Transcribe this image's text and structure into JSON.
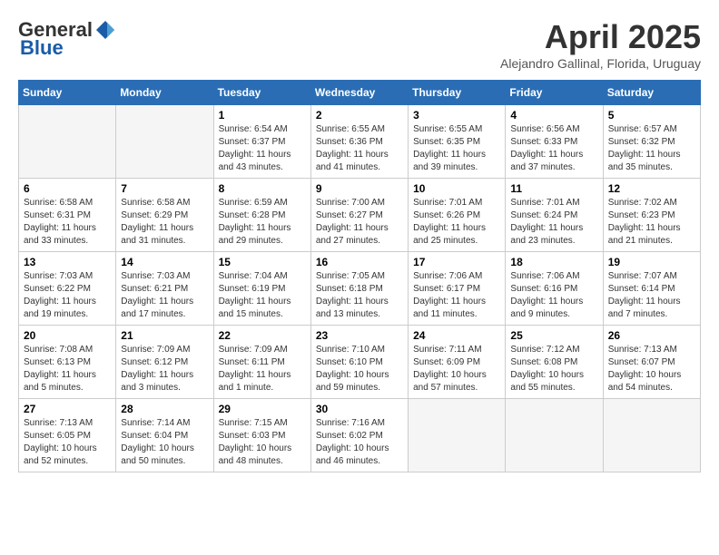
{
  "header": {
    "logo_general": "General",
    "logo_blue": "Blue",
    "month_title": "April 2025",
    "subtitle": "Alejandro Gallinal, Florida, Uruguay"
  },
  "days_of_week": [
    "Sunday",
    "Monday",
    "Tuesday",
    "Wednesday",
    "Thursday",
    "Friday",
    "Saturday"
  ],
  "weeks": [
    [
      {
        "day": "",
        "empty": true
      },
      {
        "day": "",
        "empty": true
      },
      {
        "day": "1",
        "info": "Sunrise: 6:54 AM\nSunset: 6:37 PM\nDaylight: 11 hours and 43 minutes."
      },
      {
        "day": "2",
        "info": "Sunrise: 6:55 AM\nSunset: 6:36 PM\nDaylight: 11 hours and 41 minutes."
      },
      {
        "day": "3",
        "info": "Sunrise: 6:55 AM\nSunset: 6:35 PM\nDaylight: 11 hours and 39 minutes."
      },
      {
        "day": "4",
        "info": "Sunrise: 6:56 AM\nSunset: 6:33 PM\nDaylight: 11 hours and 37 minutes."
      },
      {
        "day": "5",
        "info": "Sunrise: 6:57 AM\nSunset: 6:32 PM\nDaylight: 11 hours and 35 minutes."
      }
    ],
    [
      {
        "day": "6",
        "info": "Sunrise: 6:58 AM\nSunset: 6:31 PM\nDaylight: 11 hours and 33 minutes."
      },
      {
        "day": "7",
        "info": "Sunrise: 6:58 AM\nSunset: 6:29 PM\nDaylight: 11 hours and 31 minutes."
      },
      {
        "day": "8",
        "info": "Sunrise: 6:59 AM\nSunset: 6:28 PM\nDaylight: 11 hours and 29 minutes."
      },
      {
        "day": "9",
        "info": "Sunrise: 7:00 AM\nSunset: 6:27 PM\nDaylight: 11 hours and 27 minutes."
      },
      {
        "day": "10",
        "info": "Sunrise: 7:01 AM\nSunset: 6:26 PM\nDaylight: 11 hours and 25 minutes."
      },
      {
        "day": "11",
        "info": "Sunrise: 7:01 AM\nSunset: 6:24 PM\nDaylight: 11 hours and 23 minutes."
      },
      {
        "day": "12",
        "info": "Sunrise: 7:02 AM\nSunset: 6:23 PM\nDaylight: 11 hours and 21 minutes."
      }
    ],
    [
      {
        "day": "13",
        "info": "Sunrise: 7:03 AM\nSunset: 6:22 PM\nDaylight: 11 hours and 19 minutes."
      },
      {
        "day": "14",
        "info": "Sunrise: 7:03 AM\nSunset: 6:21 PM\nDaylight: 11 hours and 17 minutes."
      },
      {
        "day": "15",
        "info": "Sunrise: 7:04 AM\nSunset: 6:19 PM\nDaylight: 11 hours and 15 minutes."
      },
      {
        "day": "16",
        "info": "Sunrise: 7:05 AM\nSunset: 6:18 PM\nDaylight: 11 hours and 13 minutes."
      },
      {
        "day": "17",
        "info": "Sunrise: 7:06 AM\nSunset: 6:17 PM\nDaylight: 11 hours and 11 minutes."
      },
      {
        "day": "18",
        "info": "Sunrise: 7:06 AM\nSunset: 6:16 PM\nDaylight: 11 hours and 9 minutes."
      },
      {
        "day": "19",
        "info": "Sunrise: 7:07 AM\nSunset: 6:14 PM\nDaylight: 11 hours and 7 minutes."
      }
    ],
    [
      {
        "day": "20",
        "info": "Sunrise: 7:08 AM\nSunset: 6:13 PM\nDaylight: 11 hours and 5 minutes."
      },
      {
        "day": "21",
        "info": "Sunrise: 7:09 AM\nSunset: 6:12 PM\nDaylight: 11 hours and 3 minutes."
      },
      {
        "day": "22",
        "info": "Sunrise: 7:09 AM\nSunset: 6:11 PM\nDaylight: 11 hours and 1 minute."
      },
      {
        "day": "23",
        "info": "Sunrise: 7:10 AM\nSunset: 6:10 PM\nDaylight: 10 hours and 59 minutes."
      },
      {
        "day": "24",
        "info": "Sunrise: 7:11 AM\nSunset: 6:09 PM\nDaylight: 10 hours and 57 minutes."
      },
      {
        "day": "25",
        "info": "Sunrise: 7:12 AM\nSunset: 6:08 PM\nDaylight: 10 hours and 55 minutes."
      },
      {
        "day": "26",
        "info": "Sunrise: 7:13 AM\nSunset: 6:07 PM\nDaylight: 10 hours and 54 minutes."
      }
    ],
    [
      {
        "day": "27",
        "info": "Sunrise: 7:13 AM\nSunset: 6:05 PM\nDaylight: 10 hours and 52 minutes."
      },
      {
        "day": "28",
        "info": "Sunrise: 7:14 AM\nSunset: 6:04 PM\nDaylight: 10 hours and 50 minutes."
      },
      {
        "day": "29",
        "info": "Sunrise: 7:15 AM\nSunset: 6:03 PM\nDaylight: 10 hours and 48 minutes."
      },
      {
        "day": "30",
        "info": "Sunrise: 7:16 AM\nSunset: 6:02 PM\nDaylight: 10 hours and 46 minutes."
      },
      {
        "day": "",
        "empty": true
      },
      {
        "day": "",
        "empty": true
      },
      {
        "day": "",
        "empty": true
      }
    ]
  ]
}
